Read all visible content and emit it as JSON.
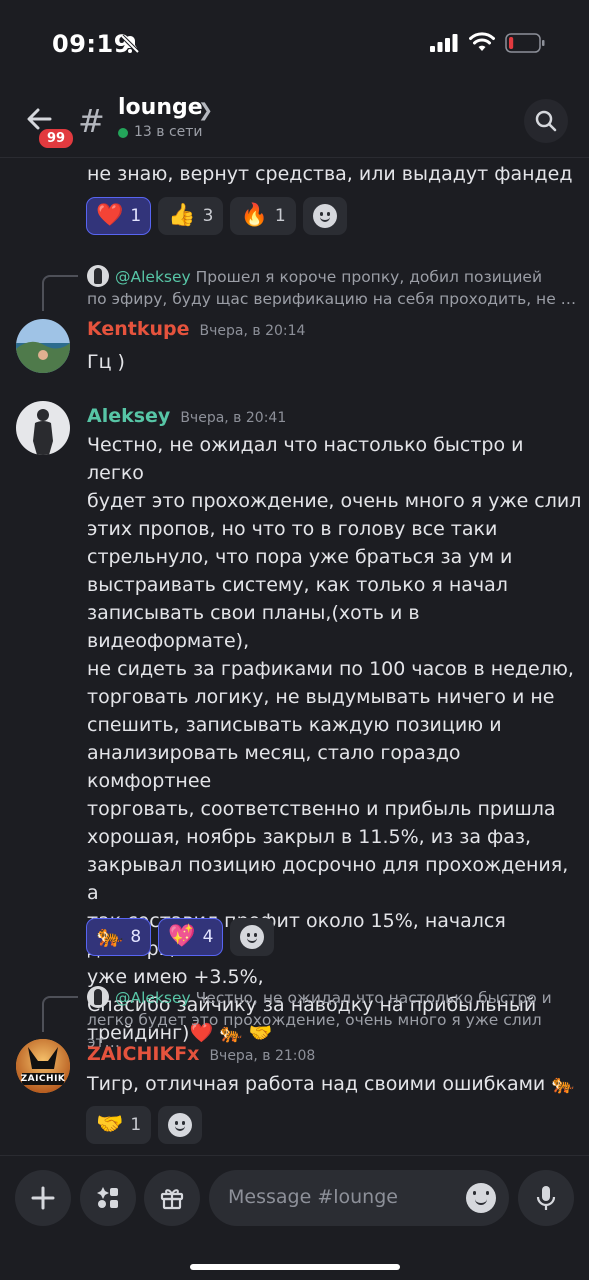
{
  "status_bar": {
    "time": "09:19",
    "battery_level": 0.15
  },
  "header": {
    "unread_badge": "99",
    "channel_name": "lounge",
    "online": "13 в сети",
    "icons": [
      "back-arrow-icon",
      "hash-icon",
      "chevron-right-icon",
      "search-icon"
    ]
  },
  "messages": [
    {
      "continuation": true,
      "text": "не знаю, вернут средства, или выдадут фандед",
      "reactions": [
        {
          "emoji": "❤️",
          "count": "1",
          "mine": true
        },
        {
          "emoji": "👍",
          "count": "3",
          "mine": false
        },
        {
          "emoji": "🔥",
          "count": "1",
          "mine": false
        }
      ]
    },
    {
      "reply_to": {
        "author": "@Aleksey",
        "text_line1": "Прошел я короче пропку, добил позицией",
        "text_line2": "по эфиру, буду щас верификацию на себя проходить, не …"
      },
      "author": "Kentkupe",
      "author_color": "#e5533d",
      "time": "Вчера, в 20:14",
      "text": "Гц )"
    },
    {
      "author": "Aleksey",
      "author_color": "#57c5a6",
      "time": "Вчера, в 20:41",
      "lines": [
        "Честно, не ожидал что настолько быстро и легко",
        "будет это прохождение, очень много я уже слил",
        "этих пропов, но что то в голову все таки",
        "стрельнуло, что пора уже браться за ум и",
        "выстраивать систему, как только я начал",
        "записывать свои планы,(хоть и в видеоформате),",
        "не сидеть за графиками по 100 часов в неделю,",
        "торговать логику, не выдумывать ничего и не",
        "спешить, записывать каждую позицию и",
        "анализировать месяц, стало гораздо комфортнее",
        "торговать, соответственно и прибыль пришла",
        "хорошая, ноябрь закрыл в 11.5%, из за фаз,",
        "закрывал позицию досрочно для прохождения, а",
        "так составил профит около 15%, начался декабрь,",
        "уже имею +3.5%,",
        "Спасибо зайчику за наводку на прибыльный",
        "трейдинг)❤️ 🐅 🤝"
      ],
      "reactions": [
        {
          "emoji": "🐅",
          "count": "8",
          "mine": true
        },
        {
          "emoji": "💖",
          "count": "4",
          "mine": true
        }
      ]
    },
    {
      "reply_to": {
        "author": "@Aleksey",
        "text_line1": "Честно, не ожидал что настолько быстро и",
        "text_line2": "легко будет это прохождение, очень много я уже слил эт…"
      },
      "author": "ZAICHIKFx",
      "author_color": "#e5533d",
      "avatar_text": "ZAICHIK",
      "time": "Вчера, в 21:08",
      "text": "Тигр, отличная работа над своими ошибками 🐅",
      "reactions": [
        {
          "emoji": "🤝",
          "count": "1",
          "mine": false
        }
      ]
    }
  ],
  "composer": {
    "placeholder": "Message #lounge",
    "icons": [
      "plus-icon",
      "apps-icon",
      "gift-icon",
      "emoji-icon",
      "microphone-icon"
    ]
  }
}
